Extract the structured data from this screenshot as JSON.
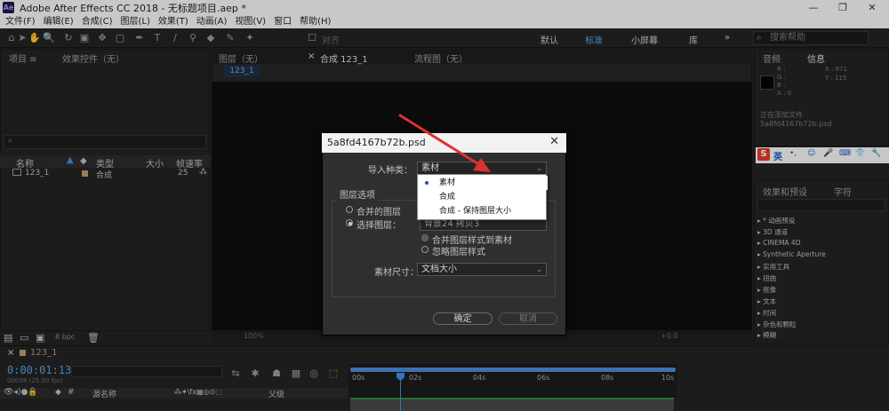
{
  "window": {
    "title": "Adobe After Effects CC 2018 - 无标题项目.aep *",
    "app_icon_label": "Ae",
    "controls": {
      "minimize": "—",
      "restore": "❐",
      "close": "✕"
    }
  },
  "menubar": [
    "文件(F)",
    "编辑(E)",
    "合成(C)",
    "图层(L)",
    "效果(T)",
    "动画(A)",
    "视图(V)",
    "窗口",
    "帮助(H)"
  ],
  "toolbar": {
    "align_label": "对齐",
    "workspaces": [
      "默认",
      "标准",
      "小屏幕",
      "库"
    ],
    "active_workspace": "标准",
    "search_help_placeholder": "搜索帮助",
    "badge": "83"
  },
  "project_panel": {
    "tab": "项目 ≡",
    "effects_controls_tab": "效果控件（无）",
    "columns": [
      "名称",
      "类型",
      "大小",
      "帧速率"
    ],
    "rows": [
      {
        "name": "123_1",
        "type": "合成",
        "size": "",
        "fps": "25"
      }
    ],
    "bpc": "8 bpc"
  },
  "comp_viewer": {
    "tabs": [
      "图层（无）",
      "合成 123_1",
      "流程图（无）"
    ],
    "active_tab": "合成 123_1",
    "subtab": "123_1",
    "zoom": "100%",
    "time_readout": "+0.0"
  },
  "info_panel": {
    "tabs": [
      "音频",
      "信息"
    ],
    "rgba_labels": [
      "R :",
      "G :",
      "B :",
      "A : 0"
    ],
    "x": "X : 871",
    "y": "Y : 115",
    "status_1": "正在添加文件",
    "status_2": "5a8fd4167b72b.psd"
  },
  "ime_toolbar": {
    "label": "英"
  },
  "effects_panel": {
    "tabs": [
      "效果和预设",
      "字符"
    ],
    "items": [
      "▸ * 动画预设",
      "▸ 3D 通道",
      "▸ CINEMA 4D",
      "▸ Synthetic Aperture",
      "▸ 实用工具",
      "▸ 扭曲",
      "▸ 抠像",
      "▸ 文本",
      "▸ 时间",
      "▸ 杂色和颗粒",
      "▸ 模糊"
    ]
  },
  "timeline": {
    "comp_tab": "123_1",
    "timecode": "0:00:01:13",
    "fps_note": "00038 (25.00 fps)",
    "layer_header": [
      "源名称",
      "父级"
    ],
    "ticks": [
      "00s",
      "02s",
      "04s",
      "06s",
      "08s",
      "10s"
    ]
  },
  "dialog": {
    "title": "5a8fd4167b72b.psd",
    "import_kind_label": "导入种类：",
    "import_kind_value": "素材",
    "layer_options_label": "图层选项",
    "merged_layers": "合并的图层",
    "choose_layer": "选择图层：",
    "choose_layer_value": "背景24 拷贝3",
    "merge_styles": "合并图层样式到素材",
    "ignore_styles": "忽略图层样式",
    "footage_size_label": "素材尺寸：",
    "footage_size_value": "文档大小",
    "ok": "确定",
    "cancel": "取消"
  },
  "dropdown_popup": {
    "options": [
      "素材",
      "合成",
      "合成 - 保持图层大小"
    ],
    "selected": "素材"
  },
  "colors": {
    "accent": "#3b8fe0",
    "arrow": "#e03030"
  }
}
